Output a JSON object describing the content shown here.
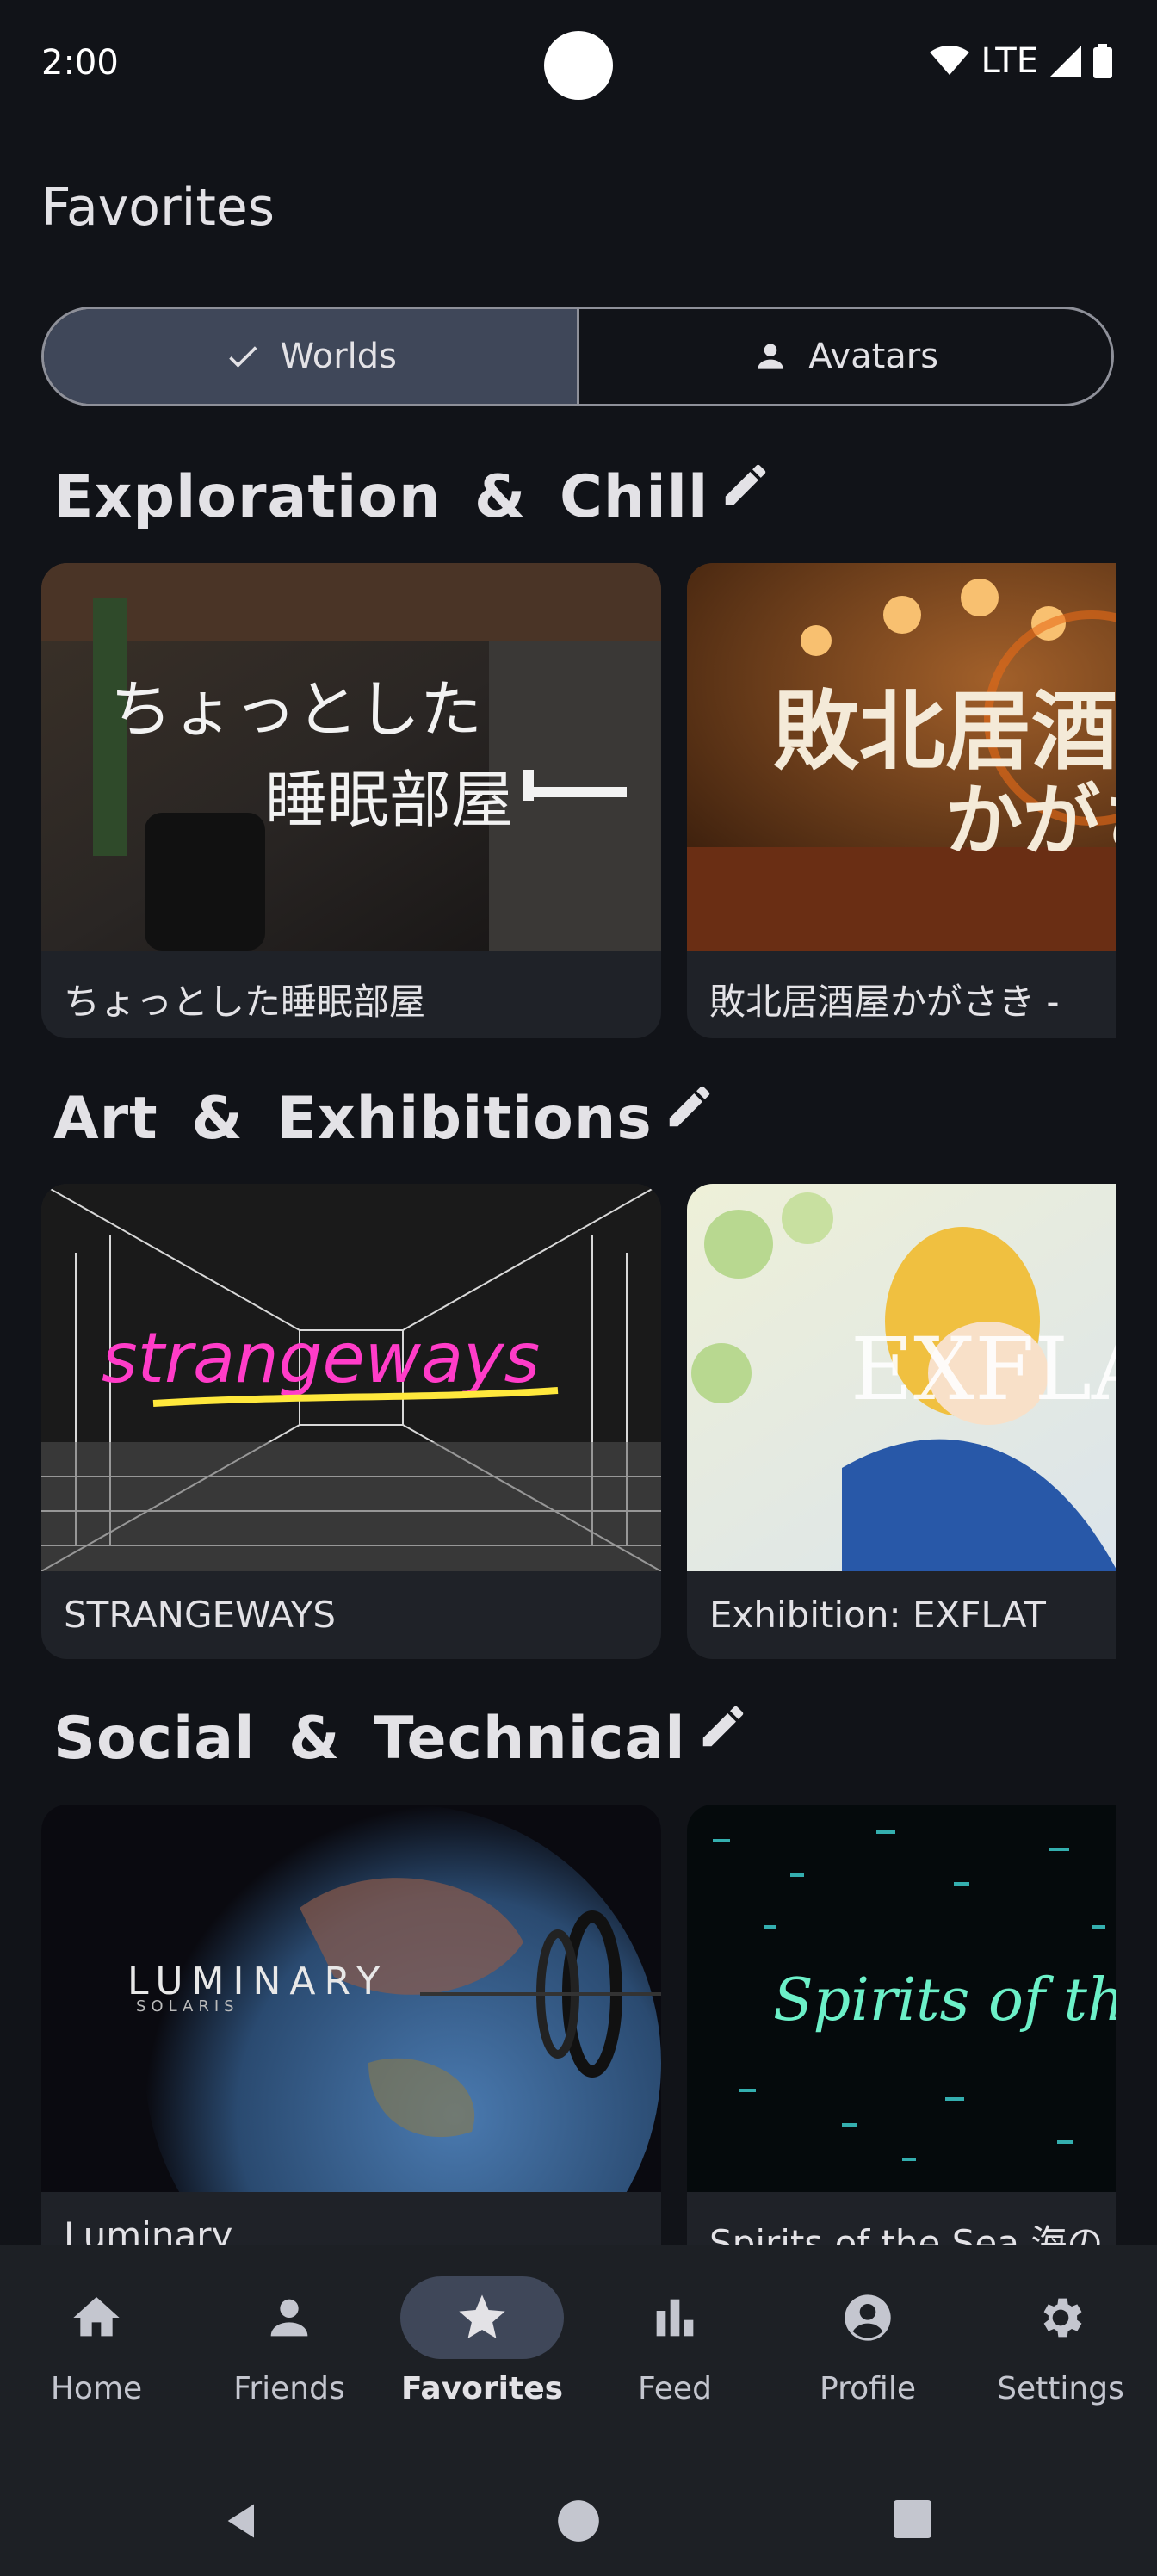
{
  "status_bar": {
    "time": "2:00",
    "network": "LTE"
  },
  "page": {
    "title": "Favorites"
  },
  "segmented": {
    "worlds_label": "Worlds",
    "avatars_label": "Avatars",
    "selected": "Worlds"
  },
  "sections": [
    {
      "title": "Exploration & Chill",
      "cards": [
        {
          "label": "ちょっとした睡眠部屋"
        },
        {
          "label": "敗北居酒屋かがさき -"
        }
      ]
    },
    {
      "title": "Art & Exhibitions",
      "cards": [
        {
          "label": "STRANGEWAYS"
        },
        {
          "label": "Exhibition: EXFLAT"
        }
      ]
    },
    {
      "title": "Social & Technical",
      "cards": [
        {
          "label": "Luminary"
        },
        {
          "label": "Spirits of the Sea 海の"
        }
      ]
    }
  ],
  "thumbnails": {
    "sleep_room": "ちょっとした 睡眠部屋",
    "izakaya": "敗北居酒屋 かがさき",
    "strangeways": "strangeways",
    "exflat": "EXFLAT",
    "luminary": "LUMINARY",
    "luminary_sub": "SOLARIS",
    "spirits": "Spirits of the"
  },
  "bottom_nav": {
    "items": [
      {
        "label": "Home",
        "icon": "home-icon"
      },
      {
        "label": "Friends",
        "icon": "person-icon"
      },
      {
        "label": "Favorites",
        "icon": "star-icon"
      },
      {
        "label": "Feed",
        "icon": "bar-chart-icon"
      },
      {
        "label": "Profile",
        "icon": "account-circle-icon"
      },
      {
        "label": "Settings",
        "icon": "gear-icon"
      }
    ],
    "active": "Favorites"
  },
  "colors": {
    "background": "#111318",
    "selected_segment": "#3f4759",
    "nav_background": "#1d2025",
    "card_background": "#1f2228"
  }
}
